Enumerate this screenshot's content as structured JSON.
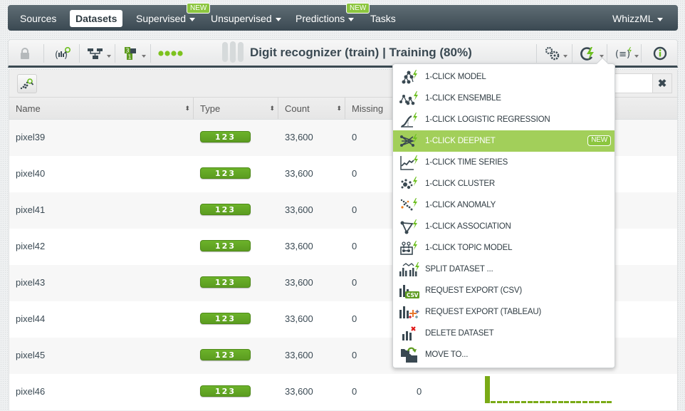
{
  "nav": {
    "items": [
      {
        "label": "Sources",
        "active": false
      },
      {
        "label": "Datasets",
        "active": true
      },
      {
        "label": "Supervised",
        "has_caret": true,
        "badge": "NEW"
      },
      {
        "label": "Unsupervised",
        "has_caret": true
      },
      {
        "label": "Predictions",
        "has_caret": true,
        "badge": "NEW"
      },
      {
        "label": "Tasks",
        "has_caret": false
      }
    ],
    "right_item": {
      "label": "WhizzML",
      "has_caret": true
    }
  },
  "toolbar": {
    "title": "Digit recognizer (train) | Training (80%)",
    "icons": [
      "lock-icon",
      "field-search-icon",
      "model-tree-icon",
      "dataset-split-icon",
      "status-dots-icon",
      "settings-gears-icon",
      "one-click-icon",
      "whizzml-script-icon",
      "info-icon"
    ]
  },
  "subbar": {
    "search": {
      "value": "",
      "placeholder": ""
    },
    "clear_label": "✖"
  },
  "table": {
    "columns": [
      "Name",
      "Type",
      "Count",
      "Missing"
    ],
    "rows": [
      {
        "name": "pixel39",
        "type": "123",
        "count": "33,600",
        "missing": "0"
      },
      {
        "name": "pixel40",
        "type": "123",
        "count": "33,600",
        "missing": "0"
      },
      {
        "name": "pixel41",
        "type": "123",
        "count": "33,600",
        "missing": "0"
      },
      {
        "name": "pixel42",
        "type": "123",
        "count": "33,600",
        "missing": "0"
      },
      {
        "name": "pixel43",
        "type": "123",
        "count": "33,600",
        "missing": "0"
      },
      {
        "name": "pixel44",
        "type": "123",
        "count": "33,600",
        "missing": "0"
      },
      {
        "name": "pixel45",
        "type": "123",
        "count": "33,600",
        "missing": "0"
      },
      {
        "name": "pixel46",
        "type": "123",
        "count": "33,600",
        "missing": "0",
        "errors": "0"
      }
    ]
  },
  "menu": {
    "items": [
      {
        "label": "1-CLICK MODEL",
        "icon": "model-icon"
      },
      {
        "label": "1-CLICK ENSEMBLE",
        "icon": "ensemble-icon"
      },
      {
        "label": "1-CLICK LOGISTIC REGRESSION",
        "icon": "logistic-regression-icon"
      },
      {
        "label": "1-CLICK DEEPNET",
        "icon": "deepnet-icon",
        "highlight": true,
        "badge": "NEW"
      },
      {
        "label": "1-CLICK TIME SERIES",
        "icon": "time-series-icon"
      },
      {
        "label": "1-CLICK CLUSTER",
        "icon": "cluster-icon"
      },
      {
        "label": "1-CLICK ANOMALY",
        "icon": "anomaly-icon"
      },
      {
        "label": "1-CLICK ASSOCIATION",
        "icon": "association-icon"
      },
      {
        "label": "1-CLICK TOPIC MODEL",
        "icon": "topic-model-icon"
      },
      {
        "label": "SPLIT DATASET ...",
        "icon": "split-dataset-icon"
      },
      {
        "label": "REQUEST EXPORT (CSV)",
        "icon": "export-csv-icon"
      },
      {
        "label": "REQUEST EXPORT (TABLEAU)",
        "icon": "export-tableau-icon"
      },
      {
        "label": "DELETE DATASET",
        "icon": "delete-dataset-icon"
      },
      {
        "label": "MOVE TO...",
        "icon": "move-to-icon"
      }
    ]
  },
  "colors": {
    "nav_bg": "#4a5962",
    "accent_green": "#8cc63f",
    "type_pill": "#62a824",
    "menu_highlight": "#a2cf5a",
    "bolt": "#6cbf1f"
  }
}
